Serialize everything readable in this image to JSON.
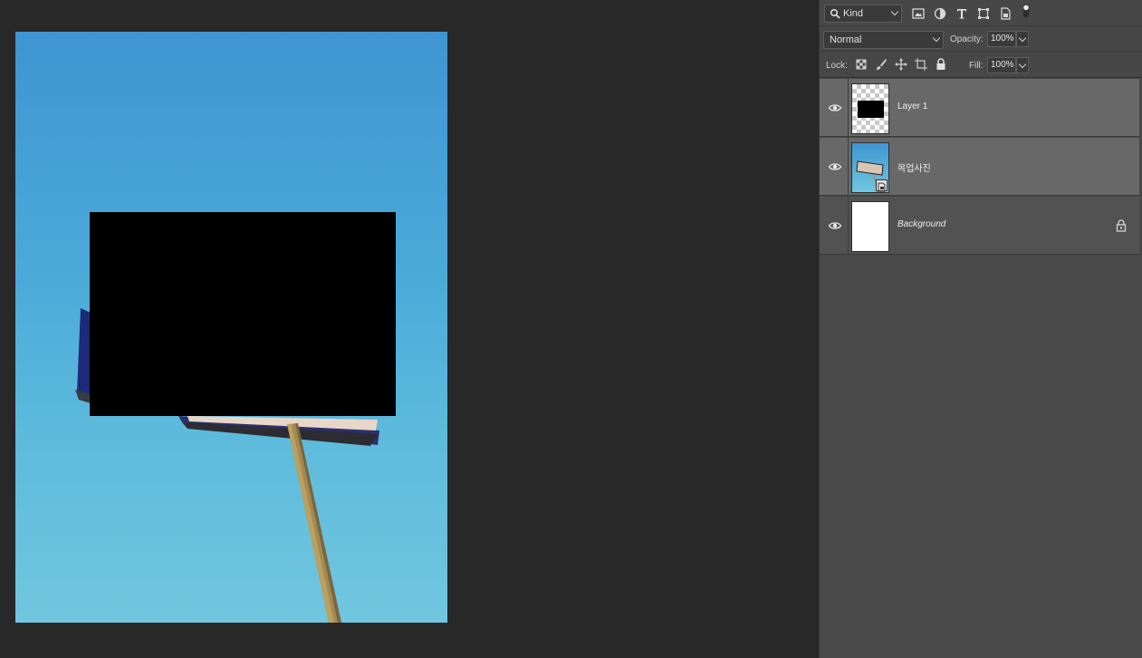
{
  "filter": {
    "kind_label": "Kind",
    "icons": [
      "image-filter-icon",
      "adjustment-filter-icon",
      "type-filter-icon",
      "shape-filter-icon",
      "smart-object-filter-icon",
      "filter-toggle-icon"
    ]
  },
  "blend": {
    "mode": "Normal",
    "opacity_label": "Opacity:",
    "opacity_value": "100%"
  },
  "lock": {
    "label": "Lock:",
    "icons": [
      "lock-transparent-icon",
      "lock-image-icon",
      "lock-position-icon",
      "lock-artboard-icon",
      "lock-all-icon"
    ],
    "fill_label": "Fill:",
    "fill_value": "100%"
  },
  "layers": [
    {
      "name": "Layer 1",
      "selected": true,
      "italic": false
    },
    {
      "name": "목업사진",
      "selected": true,
      "italic": false
    },
    {
      "name": "Background",
      "selected": false,
      "italic": true,
      "locked": true
    }
  ],
  "colors": {
    "canvas_bg": "#282828",
    "panel_bg": "#474747",
    "selected_row": "#686868",
    "sky_top": "#3f95d2",
    "sky_bottom": "#71c6de"
  }
}
